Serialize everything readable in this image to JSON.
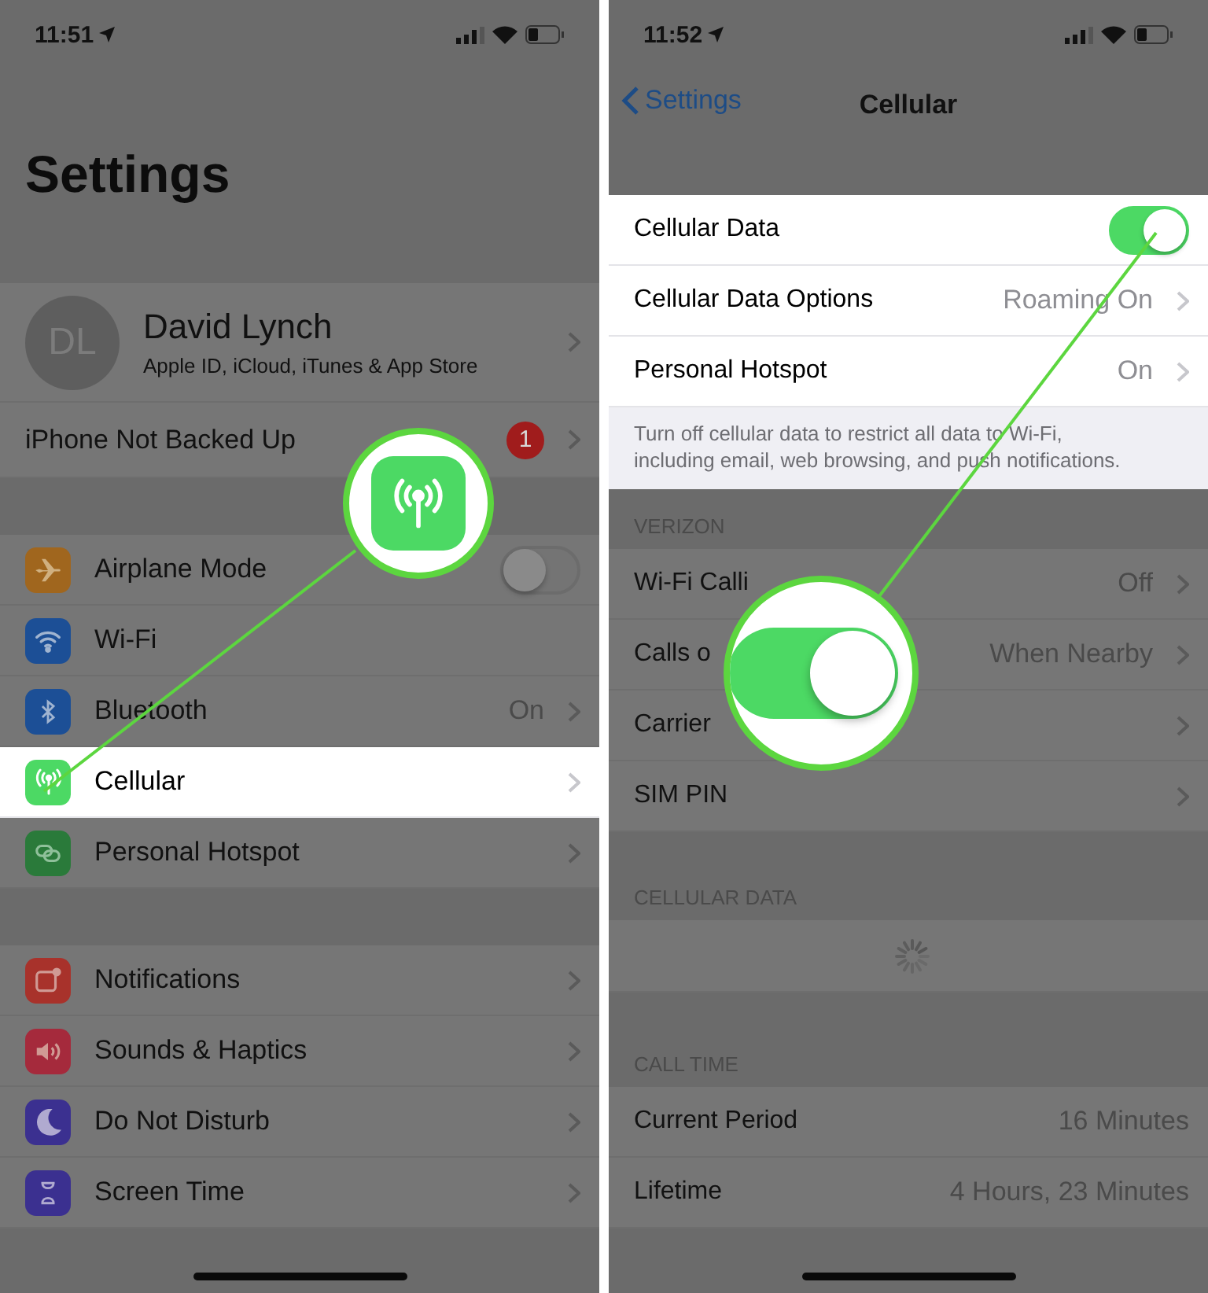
{
  "left_screen": {
    "status_bar": {
      "time": "11:51"
    },
    "title": "Settings",
    "sections": [
      {
        "rows": [
          {
            "kind": "profile",
            "initials": "DL",
            "label": "David Lynch",
            "subtitle": "Apple ID, iCloud, iTunes & App Store",
            "chevron": true,
            "highlighted": false
          },
          {
            "kind": "badge",
            "label": "iPhone Not Backed Up",
            "badge": "1",
            "chevron": true,
            "highlighted": false
          }
        ]
      },
      {
        "rows": [
          {
            "kind": "toggle",
            "label": "Airplane Mode",
            "color": "#a0661e",
            "on": false,
            "chevron": false,
            "highlighted": false
          },
          {
            "kind": "value",
            "label": "Wi-Fi",
            "color": "#1c4f96",
            "chevron": false,
            "highlighted": false
          },
          {
            "kind": "value",
            "label": "Bluetooth",
            "color": "#1c4f96",
            "value": "On",
            "chevron": true,
            "highlighted": false
          },
          {
            "kind": "value",
            "label": "Cellular",
            "color": "#4cd964",
            "chevron": true,
            "highlighted": true
          },
          {
            "kind": "value",
            "label": "Personal Hotspot",
            "color": "#2a7a3a",
            "chevron": true,
            "highlighted": false
          }
        ]
      },
      {
        "rows": [
          {
            "kind": "value",
            "label": "Notifications",
            "color": "#a8322b",
            "chevron": true,
            "highlighted": false
          },
          {
            "kind": "value",
            "label": "Sounds & Haptics",
            "color": "#a52a3c",
            "chevron": true,
            "highlighted": false
          },
          {
            "kind": "value",
            "label": "Do Not Disturb",
            "color": "#3b3090",
            "chevron": true,
            "highlighted": false
          },
          {
            "kind": "value",
            "label": "Screen Time",
            "color": "#3b3090",
            "chevron": true,
            "highlighted": false
          }
        ]
      }
    ]
  },
  "right_screen": {
    "status_bar": {
      "time": "11:52"
    },
    "nav": {
      "back": "Settings",
      "title": "Cellular"
    },
    "sections": [
      {
        "rows": [
          {
            "kind": "toggle",
            "label": "Cellular Data",
            "on": true,
            "chevron": false,
            "highlighted": true
          },
          {
            "kind": "value",
            "label": "Cellular Data Options",
            "value": "Roaming On",
            "chevron": true,
            "highlighted": true
          },
          {
            "kind": "value",
            "label": "Personal Hotspot",
            "value": "On",
            "chevron": true,
            "highlighted": true
          }
        ],
        "footer": {
          "text": "Turn off cellular data to restrict all data to Wi-Fi, including email, web browsing, and push notifications.",
          "highlighted": true
        }
      },
      {
        "header": "VERIZON",
        "rows": [
          {
            "kind": "value",
            "label": "Wi-Fi Calli",
            "value": "Off",
            "chevron": true,
            "highlighted": false
          },
          {
            "kind": "value",
            "label": "Calls o",
            "value": "When Nearby",
            "chevron": true,
            "highlighted": false
          },
          {
            "kind": "value",
            "label": "Carrier",
            "chevron": true,
            "highlighted": false
          },
          {
            "kind": "value",
            "label": "SIM PIN",
            "chevron": true,
            "highlighted": false
          }
        ]
      },
      {
        "header": "CELLULAR DATA",
        "rows": [
          {
            "kind": "spinner",
            "chevron": false,
            "highlighted": false
          }
        ]
      },
      {
        "header": "CALL TIME",
        "rows": [
          {
            "kind": "value",
            "label": "Current Period",
            "value": "16 Minutes",
            "chevron": false,
            "highlighted": false
          },
          {
            "kind": "value",
            "label": "Lifetime",
            "value": "4 Hours, 23 Minutes",
            "chevron": false,
            "highlighted": false
          }
        ]
      }
    ]
  },
  "callouts": [
    {
      "kind": "app-icon"
    },
    {
      "kind": "toggle",
      "on": true
    }
  ]
}
